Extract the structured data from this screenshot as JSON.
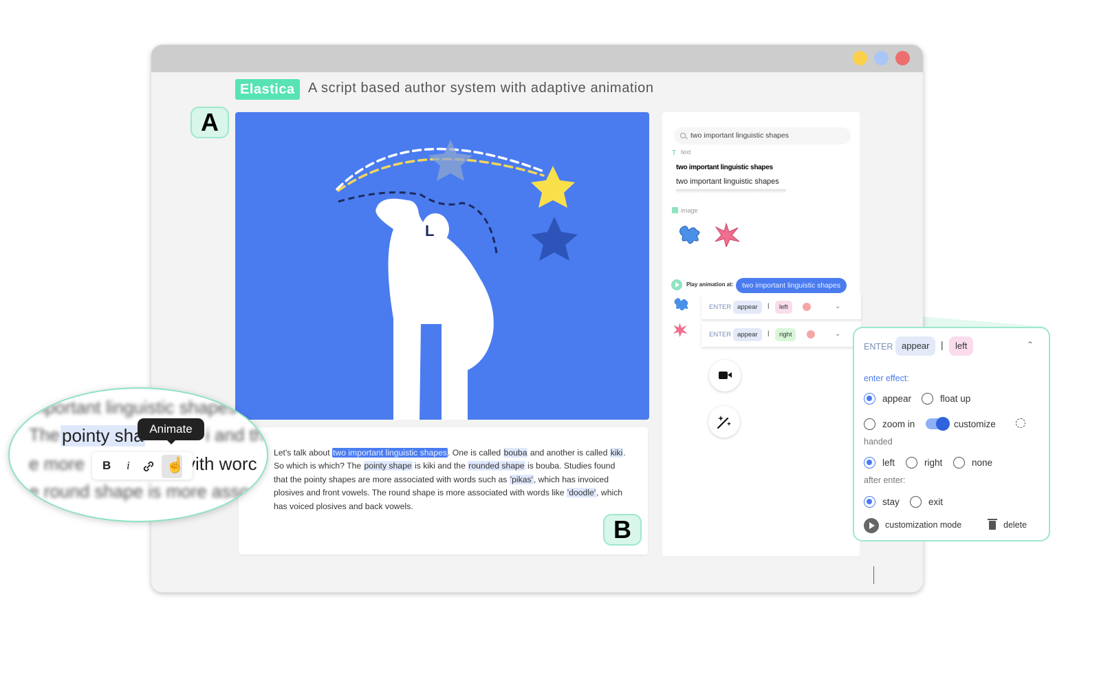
{
  "app": {
    "brand": "Elastica",
    "tagline": "A script based author system with adaptive animation"
  },
  "badges": {
    "a": "A",
    "b": "B"
  },
  "script": {
    "t1": "Let's talk about ",
    "h_shapes": "two important linguistic shapes",
    "t2": ". One is called ",
    "h_bouba": "bouba",
    "t3": " and another is called ",
    "h_kiki": "kiki",
    "t4": ". So which is which? The ",
    "h_pointy": "pointy shape",
    "t5": " is kiki and the ",
    "h_rounded": "rounded shape",
    "t6": " is bouba. Studies found that the pointy shapes are more associated with words such as ",
    "h_pikas": "'pikas'",
    "t7": ", which has invoiced plosives and front vowels. The round shape is more associated with words like ",
    "h_doodle": "'doodle'",
    "t8": ", which has voiced plosives and back vowels."
  },
  "panel": {
    "search_value": "two important linguistic shapes",
    "text_label": "text",
    "result_bold": "two important linguistic shapes",
    "result_normal": "two important linguistic shapes",
    "image_label": "image",
    "play_label": "Play animation at:",
    "play_chip": "two important linguistic shapes",
    "rows": [
      {
        "enter": "ENTER",
        "effect": "appear",
        "sep": "|",
        "hand": "left"
      },
      {
        "enter": "ENTER",
        "effect": "appear",
        "sep": "|",
        "hand": "right"
      }
    ]
  },
  "detail": {
    "enter": "ENTER",
    "effect": "appear",
    "sep": "|",
    "hand": "left",
    "enter_effect_label": "enter effect:",
    "opt_appear": "appear",
    "opt_float_up": "float up",
    "opt_zoom_in": "zoom in",
    "opt_customize": "customize",
    "handed_label": "handed",
    "opt_left": "left",
    "opt_right": "right",
    "opt_none": "none",
    "after_enter_label": "after enter:",
    "opt_stay": "stay",
    "opt_exit": "exit",
    "customization_mode": "customization mode",
    "delete": "delete",
    "selected": {
      "enter_effect": "appear",
      "handed": "left",
      "after_enter": "stay",
      "customize_toggle": true
    }
  },
  "bubble": {
    "line1": "mportant linguistic shapes",
    "line2_pre": "The ",
    "line2_sel": "pointy sha",
    "line2_post": "i and th",
    "line3_pre": "e more",
    "line3_post": "vith worc",
    "line4": "e round shape is more assoc",
    "tooltip": "Animate",
    "bold": "B",
    "italic": "i"
  },
  "colors": {
    "accent": "#4a7cf0",
    "brand": "#57e3b3",
    "badge_bg": "#d8f6ea",
    "left_chip": "#fadcec",
    "right_chip": "#d9f7d8"
  },
  "icons": [
    "search-icon",
    "text-icon",
    "image-icon",
    "play-icon",
    "chevron-down-icon",
    "chevron-up-icon",
    "camera-icon",
    "magic-wand-icon",
    "reset-icon",
    "trash-icon",
    "link-icon",
    "hand-cursor-icon"
  ]
}
